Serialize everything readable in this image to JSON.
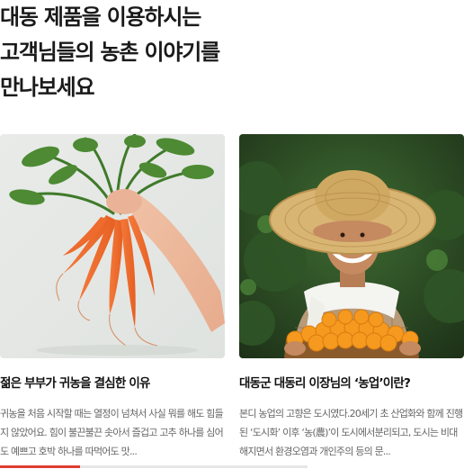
{
  "headline": {
    "lines": [
      "대동 제품을 이용하시는",
      "고객님들의 농촌 이야기를",
      "만나보세요"
    ]
  },
  "cards": [
    {
      "title": "젊은 부부가 귀농을 결심한 이유",
      "excerpt": "귀농을 처음 시작할 때는 열정이 넘쳐서 사실 뭐를 해도 힘들지 않았어요. 힘이 불끈불끈 솟아서 즐겁고 고추 하나를 심어도 예쁘고 호박 하나를 따먹어도 맛...",
      "image": "carrots-bunch-photo"
    },
    {
      "title": "대동군 대동리 이장님의 ‘농업’이란?",
      "excerpt": "본디 농업의 고향은 도시였다.20세기 초 산업화와 함께 진행된 ‘도시화’ 이후 ‘농(農)’이 도시에서분리되고, 도시는 비대해지면서 환경오염과 개인주의 등의 문...",
      "image": "farmer-with-oranges-photo"
    }
  ],
  "carousel": {
    "progress_fraction": 0.26
  },
  "colors": {
    "accent": "#e03c31",
    "track": "#e6e6e6"
  }
}
